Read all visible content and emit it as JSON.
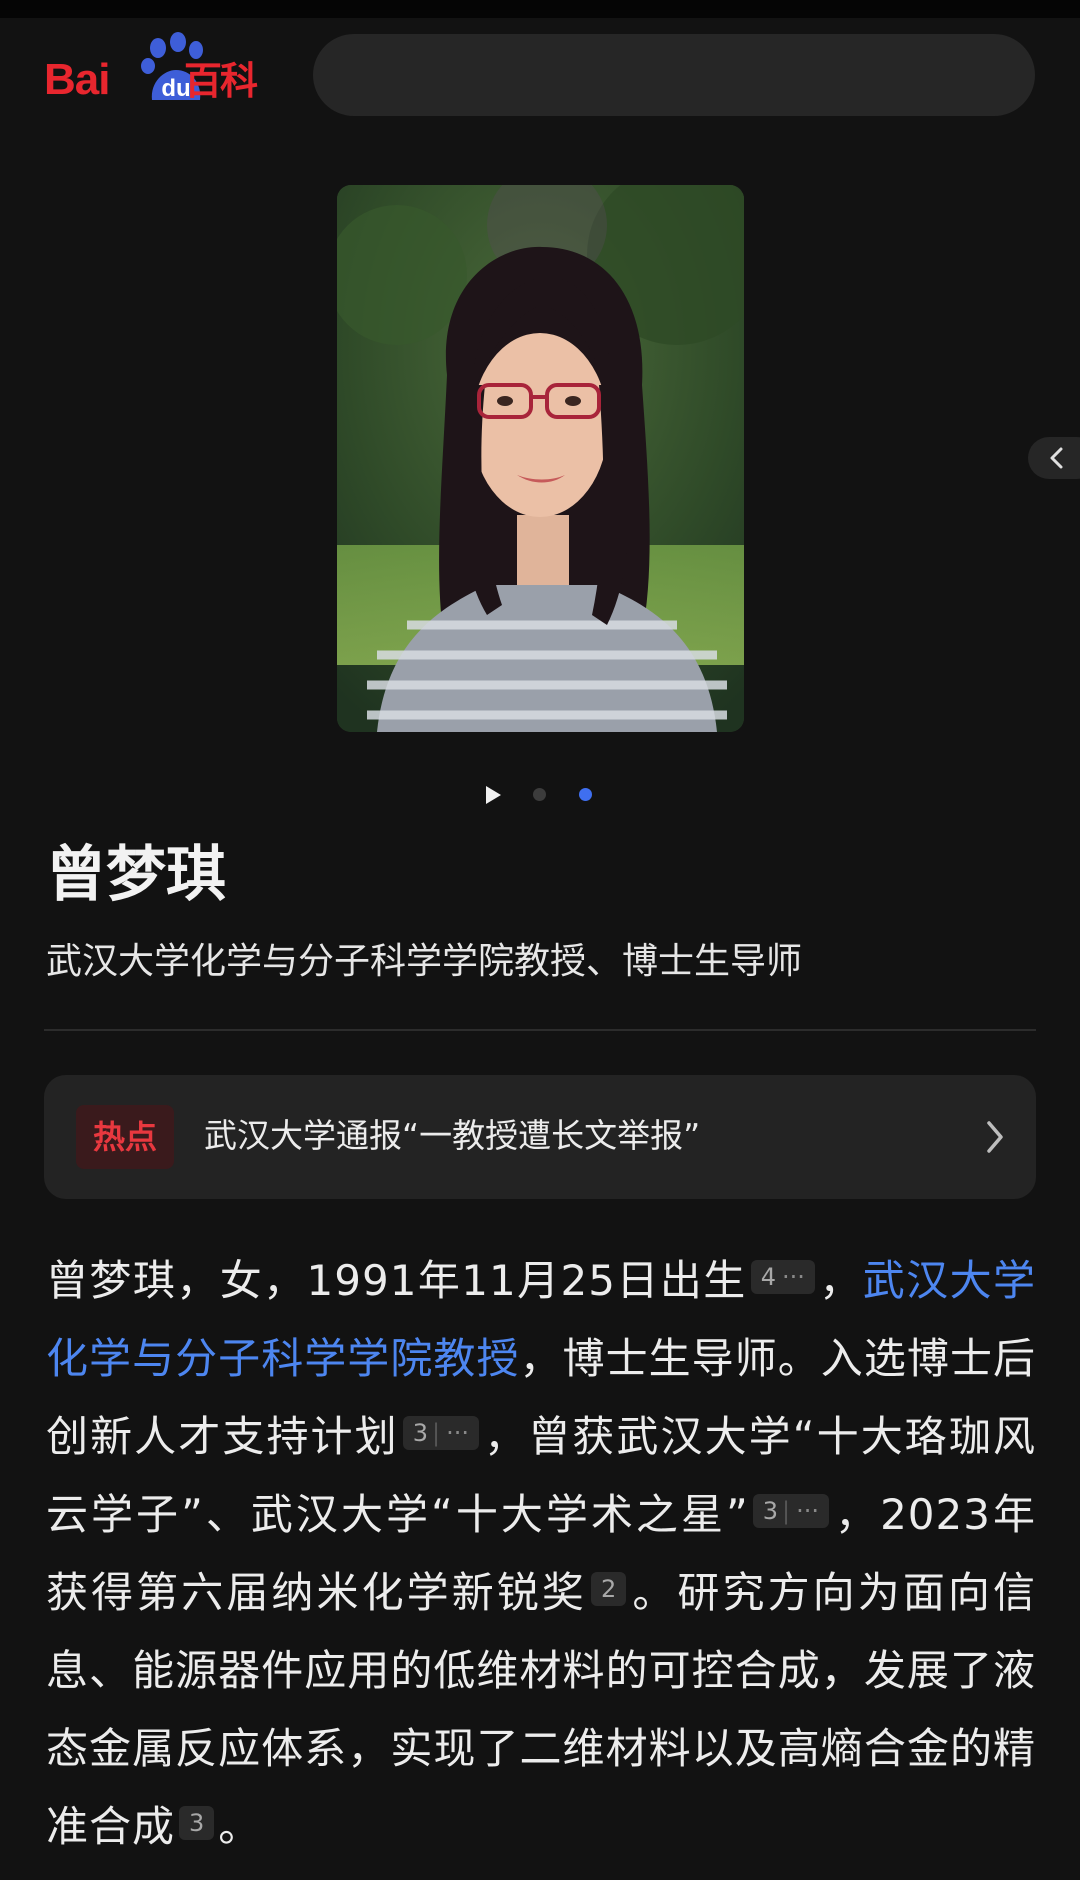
{
  "header": {
    "logo_text": "Bai du 百科",
    "logo_bai": "Bai",
    "logo_du": "du",
    "logo_baike": "百科",
    "search_placeholder": ""
  },
  "gallery": {
    "total_dots": 2,
    "active_dot": 2,
    "has_video": true
  },
  "person": {
    "name": "曾梦琪",
    "subtitle": "武汉大学化学与分子科学学院教授、博士生导师"
  },
  "hot": {
    "badge": "热点",
    "text": "武汉大学通报“一教授遭长文举报”"
  },
  "summary": {
    "p1": "曾梦琪，女，1991年11月25日出生",
    "cite1": "4",
    "p2": "，",
    "link": "武汉大学化学与分子科学学院教授",
    "p3": "，博士生导师。入选博士后创新人才支持计划",
    "cite2": "3",
    "p4": "，曾获武汉大学“十大珞珈风云学子”、武汉大学“十大学术之星”",
    "cite3": "3",
    "p5": "，2023年获得第六届纳米化学新锐奖",
    "cite4": "2",
    "p6": "。研究方向为面向信息、能源器件应用的低维材料的可控合成，发展了液态金属反应体系，实现了二维材料以及高熵合金的精准合成",
    "cite5": "3",
    "p7": "。",
    "ellipsis": "···"
  },
  "colors": {
    "background": "#121212",
    "brand_red": "#e8262e",
    "link_blue": "#4d86f0",
    "active_dot": "#3f6ff0",
    "hot_red": "#e8383f"
  }
}
